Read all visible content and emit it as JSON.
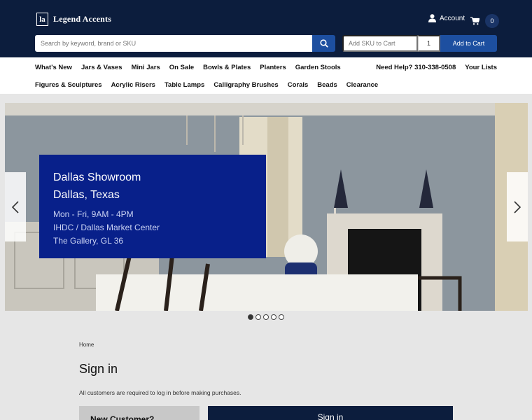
{
  "header": {
    "logo_mark": "la",
    "brand": "Legend Accents",
    "account_label": "Account",
    "cart_count": "0",
    "search_placeholder": "Search by keyword, brand or SKU",
    "sku_placeholder": "Add SKU to Cart",
    "qty_value": "1",
    "add_to_cart_label": "Add to Cart"
  },
  "nav": {
    "row1": [
      "What's New",
      "Jars & Vases",
      "Mini Jars",
      "On Sale",
      "Bowls & Plates",
      "Planters",
      "Garden Stools"
    ],
    "row2": [
      "Figures & Sculptures",
      "Acrylic Risers",
      "Table Lamps",
      "Calligraphy Brushes",
      "Corals",
      "Beads",
      "Clearance"
    ],
    "help": "Need Help? 310-338-0508",
    "lists": "Your Lists"
  },
  "hero": {
    "line1": "Dallas Showroom",
    "line2": "Dallas, Texas",
    "line3": "Mon - Fri, 9AM - 4PM",
    "line4": "IHDC / Dallas Market Center",
    "line5": "The Gallery, GL 36",
    "slide_count": 5,
    "active_slide": 1
  },
  "page": {
    "breadcrumb": "Home",
    "title": "Sign in",
    "note": "All customers are required to log in before making purchases.",
    "new_customer": "New Customer?",
    "signin_button": "Sign in"
  },
  "colors": {
    "header_bg": "#0c1d3d",
    "accent": "#1d4fa0",
    "card_bg": "#08208a"
  }
}
